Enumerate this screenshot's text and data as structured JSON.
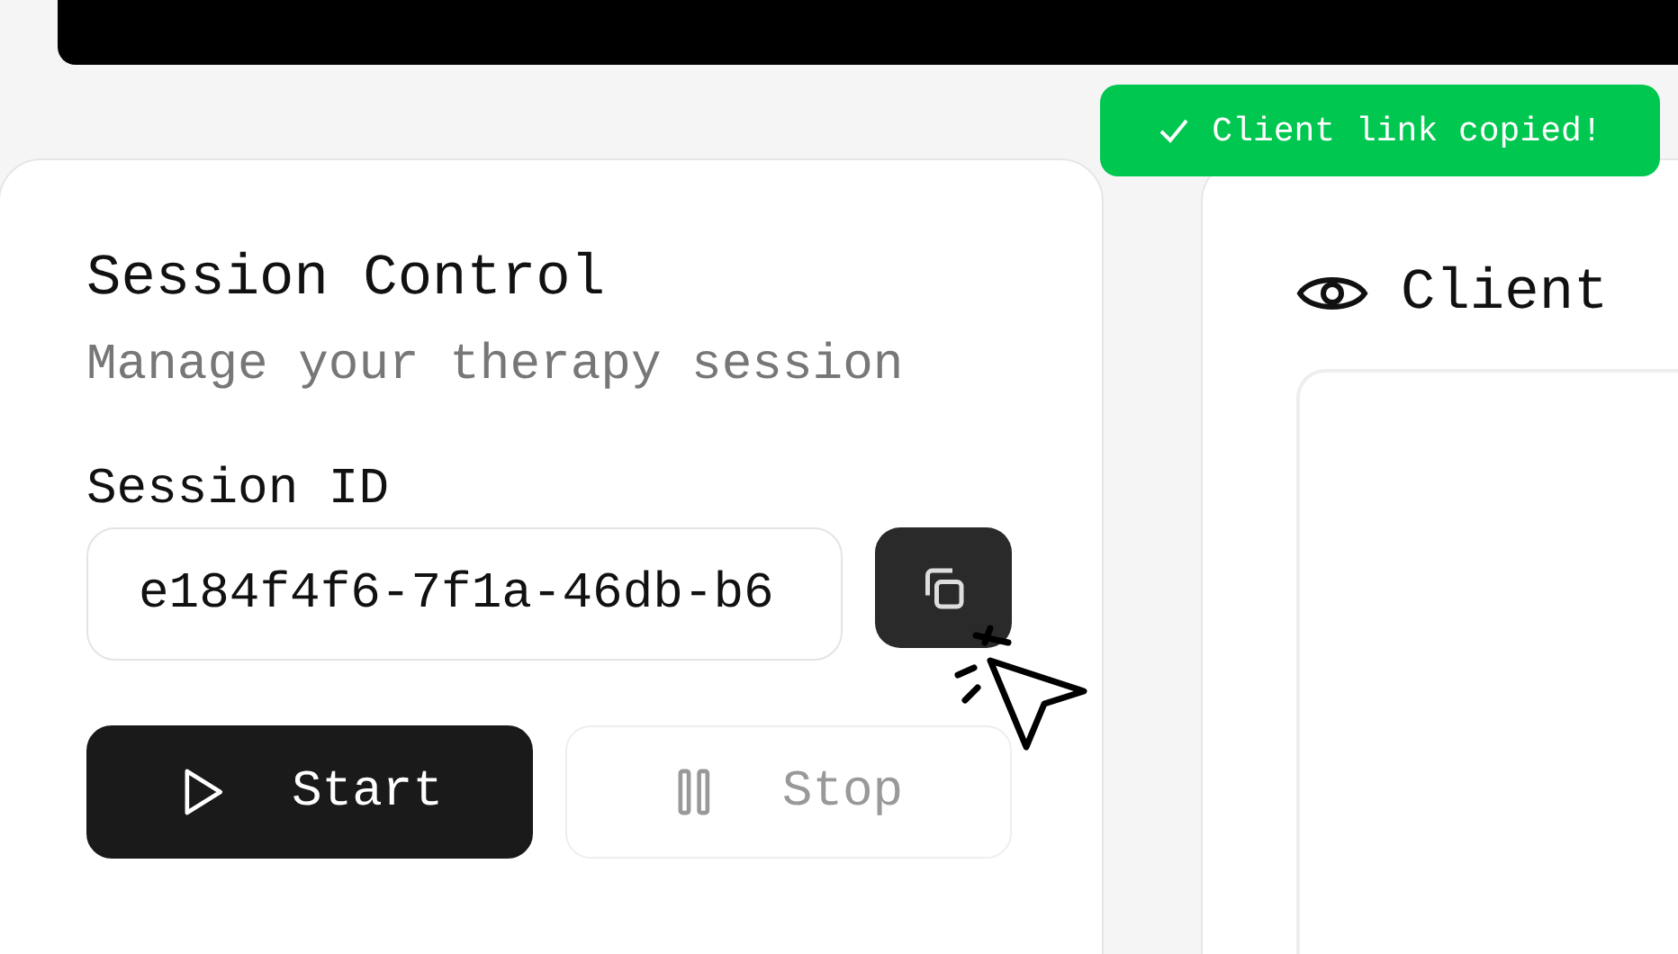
{
  "toast": {
    "text": "Client link copied!"
  },
  "session_control": {
    "title": "Session Control",
    "subtitle": "Manage your therapy session",
    "session_id_label": "Session ID",
    "session_id_value": "e184f4f6-7f1a-46db-b6",
    "buttons": [
      {
        "kind": "play",
        "label": "Start",
        "disabled": false
      },
      {
        "kind": "pause",
        "label": "Stop",
        "disabled": true
      }
    ]
  },
  "client_view": {
    "title": "Client"
  }
}
